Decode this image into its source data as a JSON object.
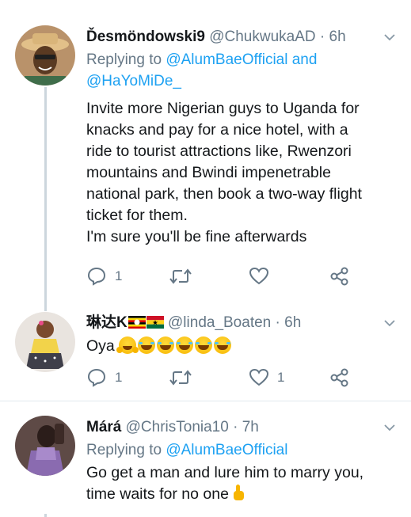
{
  "tweets": [
    {
      "name": "Ďesmöndowski9",
      "handle": "@ChukwukaAD",
      "separator": "·",
      "time": "6h",
      "replying_prefix": "Replying to",
      "replying_mention_1": "@AlumBaeOfficial",
      "replying_and": "and",
      "replying_mention_2": "@HaYoMiDe_",
      "body_lines": [
        "Invite more Nigerian guys to Uganda for",
        "knacks and pay for a nice hotel, with a",
        "ride to tourist attractions like, Rwenzori",
        "mountains and Bwindi impenetrable",
        "national park, then book a two-way flight",
        "ticket for them.",
        "I'm sure you'll be fine afterwards"
      ],
      "reply_count": "1",
      "retweet_count": "",
      "like_count": ""
    },
    {
      "name": "琳达K",
      "handle": "@linda_Boaten",
      "separator": "·",
      "time": "6h",
      "body_text": "Oya",
      "reply_count": "1",
      "retweet_count": "",
      "like_count": "1"
    },
    {
      "name": "Márá",
      "handle": "@ChrisTonia10",
      "separator": "·",
      "time": "7h",
      "replying_prefix": "Replying to",
      "replying_mention_1": "@AlumBaeOfficial",
      "body_lines": [
        "Go get a man and lure him to marry you,",
        "time waits for no one"
      ]
    }
  ],
  "colors": {
    "accent": "#1da1f2",
    "secondary_text": "#657786",
    "divider": "#e1e8ed"
  },
  "icons": [
    "reply-icon",
    "retweet-icon",
    "like-icon",
    "share-icon",
    "chevron-down-icon"
  ]
}
